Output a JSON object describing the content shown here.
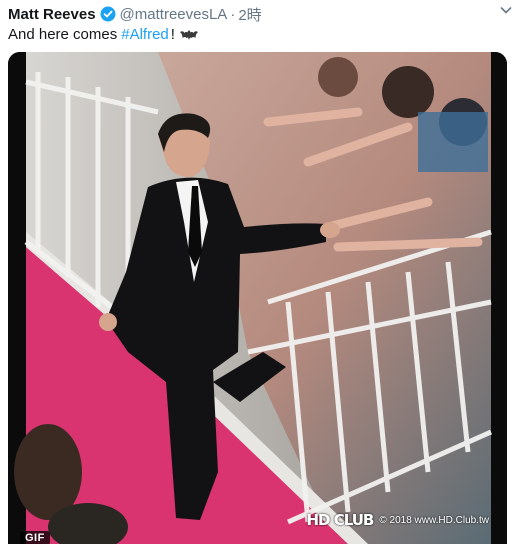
{
  "tweet": {
    "display_name": "Matt Reeves",
    "handle": "@mattreevesLA",
    "separator": "·",
    "time": "2時",
    "text_prefix": "And here comes",
    "hashtag": "#Alfred",
    "text_suffix": "!",
    "verified_icon": "verified-badge-icon",
    "emoji_icon": "bat-symbol-icon"
  },
  "media": {
    "badge": "GIF",
    "watermark_logo": "HD CLUB",
    "watermark_text": "© 2018 www.HD.Club.tw"
  },
  "colors": {
    "link": "#1da1f2",
    "verified": "#1da1f2",
    "secondary_text": "#657786",
    "carpet": "#d9346f"
  }
}
